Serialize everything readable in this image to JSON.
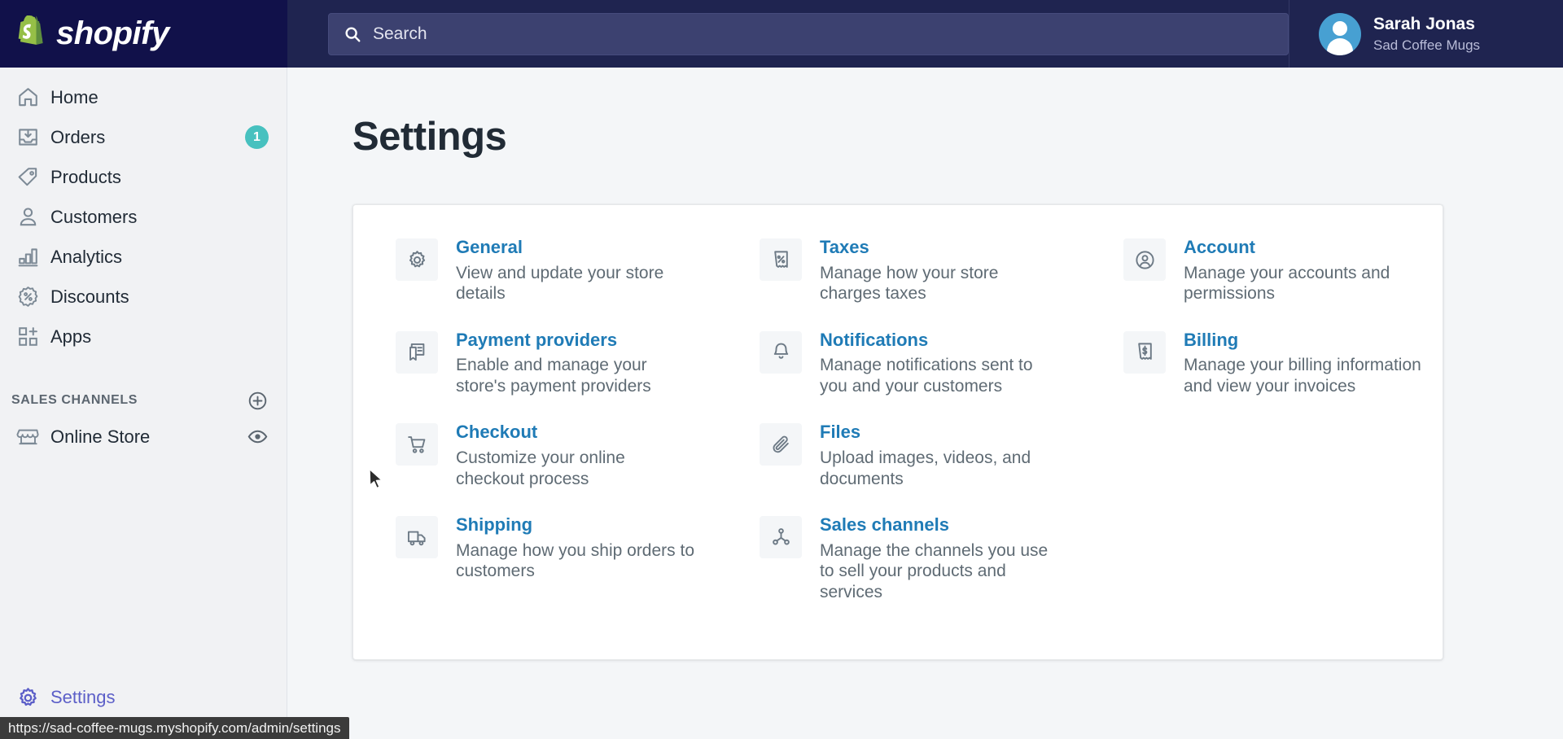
{
  "topbar": {
    "brand": "shopify",
    "search": {
      "placeholder": "Search"
    },
    "user": {
      "name": "Sarah Jonas",
      "store": "Sad Coffee Mugs"
    }
  },
  "sidebar": {
    "items": [
      {
        "label": "Home",
        "icon": "home-icon",
        "badge": ""
      },
      {
        "label": "Orders",
        "icon": "orders-icon",
        "badge": "1"
      },
      {
        "label": "Products",
        "icon": "tag-icon",
        "badge": ""
      },
      {
        "label": "Customers",
        "icon": "person-icon",
        "badge": ""
      },
      {
        "label": "Analytics",
        "icon": "bar-chart-icon",
        "badge": ""
      },
      {
        "label": "Discounts",
        "icon": "discount-percent-icon",
        "badge": ""
      },
      {
        "label": "Apps",
        "icon": "apps-grid-plus-icon",
        "badge": ""
      }
    ],
    "section": {
      "title": "SALES CHANNELS",
      "add_icon": "plus-circle-icon"
    },
    "channels": [
      {
        "label": "Online Store",
        "icon": "storefront-icon",
        "action_icon": "eye-icon"
      }
    ],
    "settings": {
      "label": "Settings",
      "icon": "gear-icon"
    }
  },
  "main": {
    "title": "Settings",
    "settings_items": [
      {
        "title": "General",
        "desc": "View and update your store details",
        "icon": "gear-icon"
      },
      {
        "title": "Taxes",
        "desc": "Manage how your store charges taxes",
        "icon": "tax-receipt-icon"
      },
      {
        "title": "Account",
        "desc": "Manage your accounts and permissions",
        "icon": "account-circle-icon"
      },
      {
        "title": "Payment providers",
        "desc": "Enable and manage your store's payment providers",
        "icon": "payment-card-icon"
      },
      {
        "title": "Notifications",
        "desc": "Manage notifications sent to you and your customers",
        "icon": "bell-icon"
      },
      {
        "title": "Billing",
        "desc": "Manage your billing information and view your invoices",
        "icon": "billing-receipt-icon"
      },
      {
        "title": "Checkout",
        "desc": "Customize your online checkout process",
        "icon": "shopping-cart-icon"
      },
      {
        "title": "Files",
        "desc": "Upload images, videos, and documents",
        "icon": "paperclip-icon"
      },
      {
        "title": "Shipping",
        "desc": "Manage how you ship orders to customers",
        "icon": "truck-icon"
      },
      {
        "title": "Sales channels",
        "desc": "Manage the channels you use to sell your products and services",
        "icon": "network-nodes-icon"
      }
    ]
  },
  "statusbar": {
    "url": "https://sad-coffee-mugs.myshopify.com/admin/settings"
  },
  "colors": {
    "topbar_bg": "#1f2450",
    "logo_zone_bg": "#11114a",
    "brand_green": "#95bf47",
    "badge_teal": "#47c1bf",
    "link_blue": "#1f7bb6",
    "settings_active": "#5c5fc8",
    "page_bg": "#f4f6f8"
  }
}
